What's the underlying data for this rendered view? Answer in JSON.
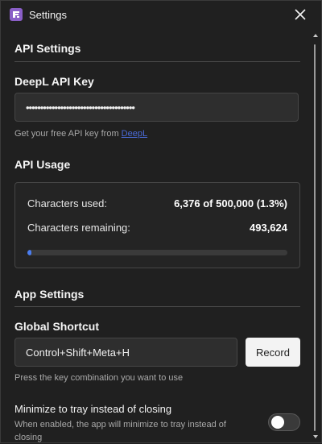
{
  "window": {
    "title": "Settings",
    "app_icon": "app-logo-icon",
    "close_icon": "close-icon",
    "accent_color": "#8a5fc7"
  },
  "api_settings": {
    "section_title": "API Settings",
    "key_label": "DeepL API Key",
    "key_value": "••••••••••••••••••••••••••••••••••••••",
    "helper_text": "Get your free API key from ",
    "helper_link": "DeepL"
  },
  "api_usage": {
    "title": "API Usage",
    "used_label": "Characters used:",
    "used_value": "6,376 of 500,000 (1.3%)",
    "remaining_label": "Characters remaining:",
    "remaining_value": "493,624",
    "progress_percent": 1.3,
    "progress_color": "#4a7df0"
  },
  "app_settings": {
    "section_title": "App Settings",
    "shortcut_label": "Global Shortcut",
    "shortcut_value": "Control+Shift+Meta+H",
    "record_label": "Record",
    "shortcut_helper": "Press the key combination you want to use",
    "tray_title": "Minimize to tray instead of closing",
    "tray_desc": "When enabled, the app will minimize to tray instead of closing",
    "tray_enabled": false
  }
}
